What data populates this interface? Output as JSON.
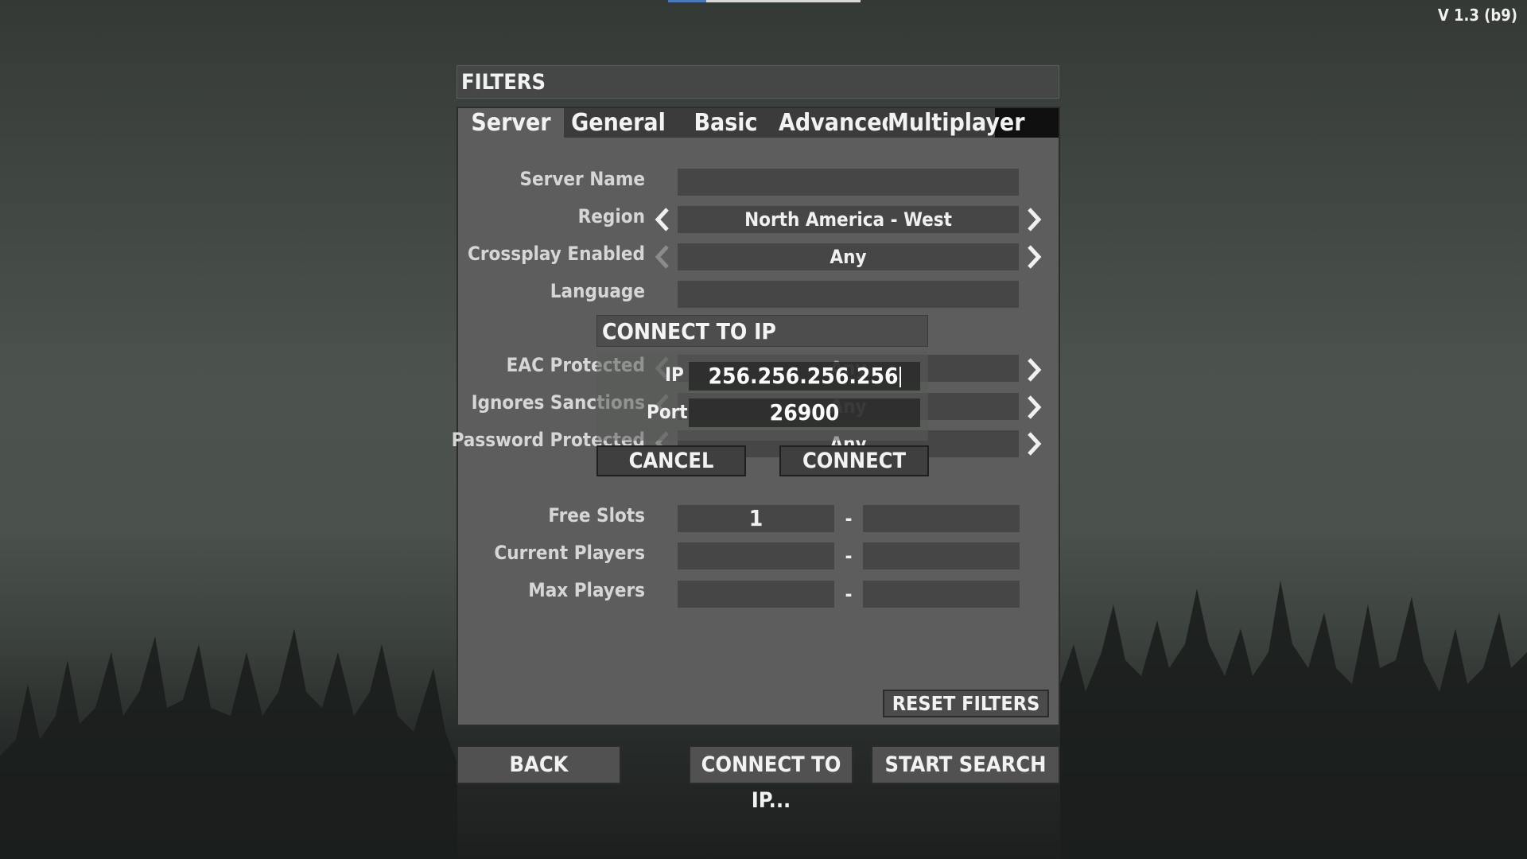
{
  "version": "V 1.3 (b9)",
  "filters": {
    "title": "FILTERS",
    "tabs": [
      "Server",
      "General",
      "Basic",
      "Advanced",
      "Multiplayer"
    ],
    "active_tab": "Server",
    "rows": {
      "server_name": {
        "label": "Server Name",
        "value": ""
      },
      "region": {
        "label": "Region",
        "value": "North America - West"
      },
      "crossplay": {
        "label": "Crossplay Enabled",
        "value": "Any"
      },
      "language": {
        "label": "Language",
        "value": ""
      },
      "eac": {
        "label": "EAC Protected",
        "value": "Any"
      },
      "sanctions": {
        "label": "Ignores Sanctions",
        "value": "Any"
      },
      "password": {
        "label": "Password Protected",
        "value": "Any"
      },
      "free_slots": {
        "label": "Free Slots",
        "min": "1",
        "max": "",
        "sep": "-"
      },
      "current_players": {
        "label": "Current Players",
        "min": "",
        "max": "",
        "sep": "-"
      },
      "max_players": {
        "label": "Max Players",
        "min": "",
        "max": "",
        "sep": "-"
      }
    },
    "reset_label": "RESET FILTERS"
  },
  "connect_dialog": {
    "title": "CONNECT TO IP",
    "ip_label": "IP",
    "ip_value": "256.256.256.256",
    "port_label": "Port",
    "port_value": "26900",
    "cancel_label": "CANCEL",
    "connect_label": "CONNECT"
  },
  "bottom": {
    "back_label": "BACK",
    "connect_ip_label": "CONNECT TO IP...",
    "start_search_label": "START SEARCH"
  },
  "colors": {
    "panel": "#5c5d5c",
    "field": "#454645",
    "accent": "#4a78b8"
  }
}
